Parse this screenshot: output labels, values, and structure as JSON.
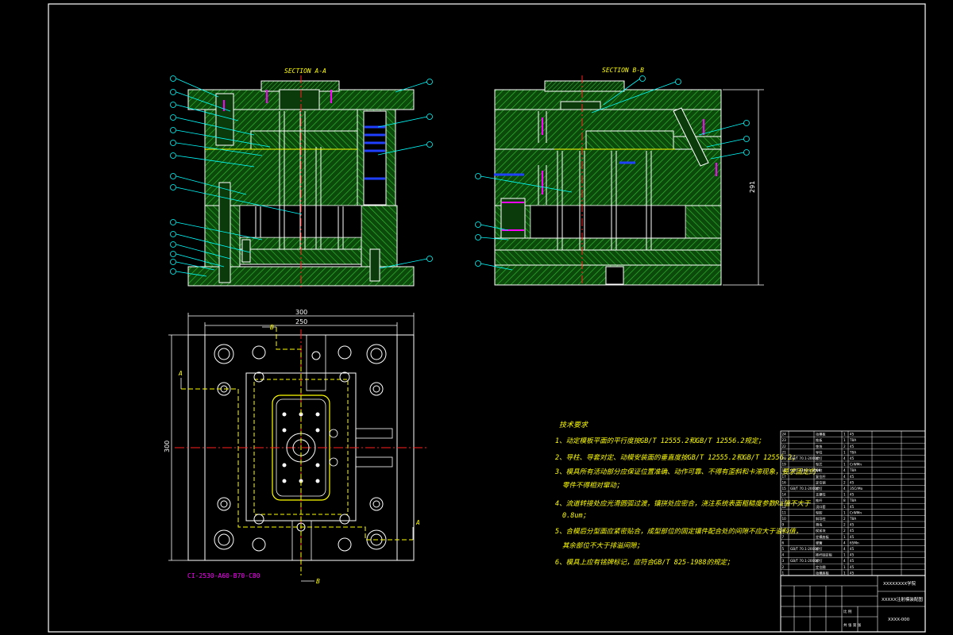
{
  "views": {
    "section_a_title": "SECTION A-A",
    "section_b_title": "SECTION B-B",
    "cut_label_a": "A",
    "cut_label_b": "B"
  },
  "dimensions": {
    "overall_width": "300",
    "inner_width": "250",
    "height_plan": "300",
    "height_section": "291"
  },
  "mold_base_code": "CI-2530-A60-B70-C80",
  "notes": {
    "heading": "技术要求",
    "items": [
      "1、动定模板平面的平行度按GB/T 12555.2和GB/T 12556.2规定；",
      "2、导柱、导套对定、动模安装面的垂直度按GB/T 12555.2和GB/T 12556.2；",
      "3、模具所有活动部分应保证位置准确、动作可靠、不得有歪斜和卡滞现象，要求固定的",
      "零件不得相对窜动；",
      "4、流道转接处应光滑圆弧过渡，镶拼处应密合，浇注系统表面粗糙度参数Ra值不大于",
      "0.8um；",
      "5、合模后分型面应紧密贴合，成型部位的固定镶件配合处的间隙不应大于溢料值，",
      "其余部位不大于排溢间隙；",
      "6、模具上应有铭牌标记，应符合GB/T 825-1988的规定；"
    ]
  },
  "title_block": {
    "company": "XXXXXXXX学院",
    "drawing_name": "XXXXX注射模装配图",
    "drawing_no": "XXXX-000",
    "scale_label": "比 例",
    "sheet_label": "共 张 第 张"
  },
  "parts_list": {
    "rows": [
      [
        "24",
        "",
        "动模板",
        "1",
        "45",
        ""
      ],
      [
        "23",
        "",
        "推板",
        "1",
        "T8A",
        ""
      ],
      [
        "22",
        "",
        "垫块",
        "2",
        "45",
        ""
      ],
      [
        "21",
        "",
        "导柱",
        "1",
        "T8A",
        ""
      ],
      [
        "20",
        "GB/T 70.1-2000",
        "螺钉",
        "4",
        "45",
        ""
      ],
      [
        "19",
        "",
        "型芯",
        "1",
        "CrWMn",
        ""
      ],
      [
        "18",
        "GB/T 4169.2-2006",
        "导柱",
        "4",
        "T8A",
        ""
      ],
      [
        "17",
        "",
        "复位杆",
        "4",
        "45",
        ""
      ],
      [
        "16",
        "",
        "定位销",
        "2",
        "45",
        ""
      ],
      [
        "15",
        "GB/T 70.1-2000",
        "螺钉",
        "4",
        "35CrMo",
        ""
      ],
      [
        "14",
        "",
        "支撑柱",
        "1",
        "45",
        ""
      ],
      [
        "13",
        "",
        "推杆",
        "8",
        "T8A",
        ""
      ],
      [
        "12",
        "",
        "浇口套",
        "1",
        "45",
        ""
      ],
      [
        "11",
        "",
        "型腔",
        "1",
        "CrWMn",
        ""
      ],
      [
        "10",
        "",
        "斜导柱",
        "2",
        "T8A",
        ""
      ],
      [
        "9",
        "",
        "滑块",
        "2",
        "45",
        ""
      ],
      [
        "8",
        "",
        "楔紧块",
        "2",
        "45",
        ""
      ],
      [
        "7",
        "",
        "定模座板",
        "1",
        "45",
        ""
      ],
      [
        "6",
        "",
        "弹簧",
        "4",
        "65Mn",
        ""
      ],
      [
        "5",
        "GB/T 70.1-2000",
        "螺钉",
        "4",
        "45",
        ""
      ],
      [
        "4",
        "",
        "推杆固定板",
        "1",
        "45",
        ""
      ],
      [
        "3",
        "GB/T 70.1-2000",
        "螺钉",
        "4",
        "45",
        ""
      ],
      [
        "2",
        "",
        "定位圈",
        "1",
        "45",
        ""
      ],
      [
        "1",
        "",
        "动模座板",
        "1",
        "45",
        ""
      ]
    ],
    "header": [
      "序号",
      "代号",
      "名称",
      "数量",
      "材料",
      "备注"
    ]
  },
  "colors": {
    "background": "#000000",
    "outline": "#ffffff",
    "hatch": "#00b000",
    "plate": "#0a5a0a",
    "center_line": "#ff2020",
    "text": "#ffff00",
    "leader": "#00ffff",
    "accent": "#ff00ff",
    "blue": "#2040ff"
  }
}
